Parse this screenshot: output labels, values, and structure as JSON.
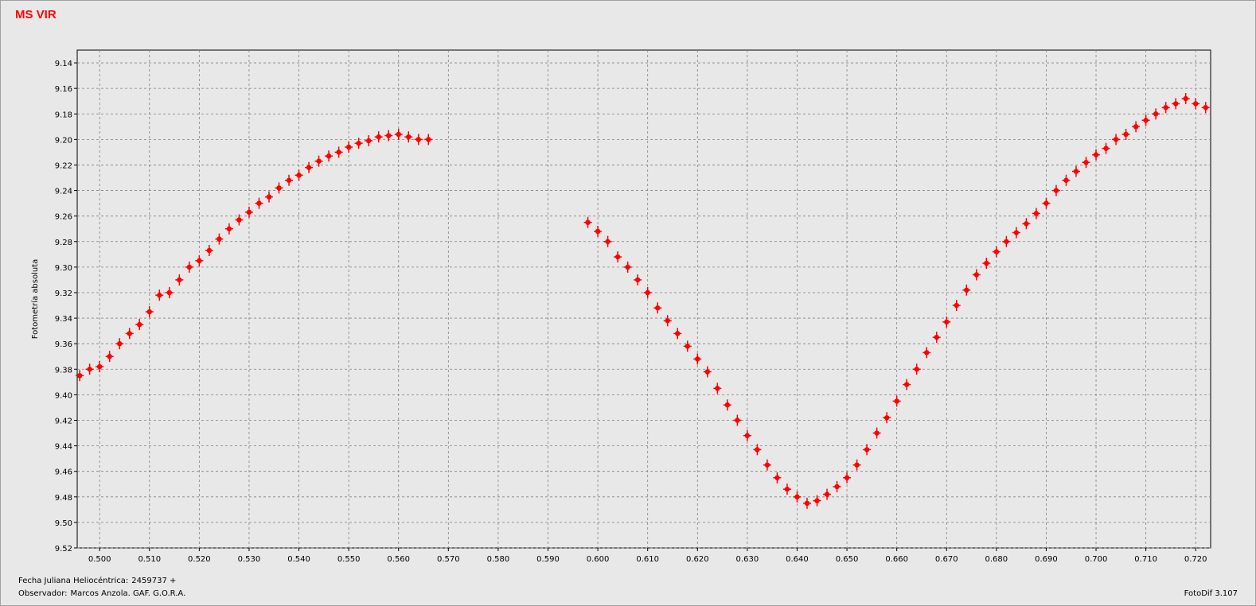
{
  "title": "MS VIR",
  "footer": {
    "hjd_label": "Fecha Juliana Heliocéntrica:",
    "hjd_value": "2459737 +",
    "observer_label": "Observador:",
    "observer_value": "Marcos Anzola. GAF. G.O.R.A.",
    "software": "FotoDif 3.107"
  },
  "colors": {
    "points": "#ff0000",
    "grid": "#808080",
    "background": "#e8e8e8"
  },
  "chart_data": {
    "type": "scatter",
    "title": "MS VIR",
    "xlabel": "Fecha Juliana Heliocéntrica: 2459737 +",
    "ylabel": "Fotometría absoluta",
    "xlim": [
      0.4955,
      0.723
    ],
    "ylim": [
      9.13,
      9.52
    ],
    "y_inverted": true,
    "grid": true,
    "legend": "none",
    "x_ticks": [
      "0.500",
      "0.510",
      "0.520",
      "0.530",
      "0.540",
      "0.550",
      "0.560",
      "0.570",
      "0.580",
      "0.590",
      "0.600",
      "0.610",
      "0.620",
      "0.630",
      "0.640",
      "0.650",
      "0.660",
      "0.670",
      "0.680",
      "0.690",
      "0.700",
      "0.710",
      "0.720"
    ],
    "y_ticks": [
      "9.14",
      "9.16",
      "9.18",
      "9.20",
      "9.22",
      "9.24",
      "9.26",
      "9.28",
      "9.30",
      "9.32",
      "9.34",
      "9.36",
      "9.38",
      "9.40",
      "9.42",
      "9.44",
      "9.46",
      "9.48",
      "9.50",
      "9.52"
    ],
    "series": [
      {
        "points": [
          [
            0.496,
            9.385
          ],
          [
            0.498,
            9.38
          ],
          [
            0.5,
            9.378
          ],
          [
            0.502,
            9.37
          ],
          [
            0.504,
            9.36
          ],
          [
            0.506,
            9.352
          ],
          [
            0.508,
            9.345
          ],
          [
            0.51,
            9.335
          ],
          [
            0.512,
            9.322
          ],
          [
            0.514,
            9.32
          ],
          [
            0.516,
            9.31
          ],
          [
            0.518,
            9.3
          ],
          [
            0.52,
            9.295
          ],
          [
            0.522,
            9.287
          ],
          [
            0.524,
            9.278
          ],
          [
            0.526,
            9.27
          ],
          [
            0.528,
            9.263
          ],
          [
            0.53,
            9.257
          ],
          [
            0.532,
            9.25
          ],
          [
            0.534,
            9.245
          ],
          [
            0.536,
            9.238
          ],
          [
            0.538,
            9.232
          ],
          [
            0.54,
            9.228
          ],
          [
            0.542,
            9.222
          ],
          [
            0.544,
            9.217
          ],
          [
            0.546,
            9.213
          ],
          [
            0.548,
            9.21
          ],
          [
            0.55,
            9.206
          ],
          [
            0.552,
            9.203
          ],
          [
            0.554,
            9.201
          ],
          [
            0.556,
            9.198
          ],
          [
            0.558,
            9.197
          ],
          [
            0.56,
            9.196
          ],
          [
            0.562,
            9.198
          ],
          [
            0.564,
            9.2
          ],
          [
            0.566,
            9.2
          ]
        ]
      },
      {
        "points": [
          [
            0.598,
            9.265
          ],
          [
            0.6,
            9.272
          ],
          [
            0.602,
            9.28
          ],
          [
            0.604,
            9.292
          ],
          [
            0.606,
            9.3
          ],
          [
            0.608,
            9.31
          ],
          [
            0.61,
            9.32
          ],
          [
            0.612,
            9.332
          ],
          [
            0.614,
            9.342
          ],
          [
            0.616,
            9.352
          ],
          [
            0.618,
            9.362
          ],
          [
            0.62,
            9.372
          ],
          [
            0.622,
            9.382
          ],
          [
            0.624,
            9.395
          ],
          [
            0.626,
            9.408
          ],
          [
            0.628,
            9.42
          ],
          [
            0.63,
            9.432
          ],
          [
            0.632,
            9.443
          ],
          [
            0.634,
            9.455
          ],
          [
            0.636,
            9.465
          ],
          [
            0.638,
            9.474
          ],
          [
            0.64,
            9.48
          ],
          [
            0.642,
            9.485
          ],
          [
            0.644,
            9.483
          ],
          [
            0.646,
            9.478
          ],
          [
            0.648,
            9.472
          ],
          [
            0.65,
            9.465
          ],
          [
            0.652,
            9.455
          ],
          [
            0.654,
            9.443
          ],
          [
            0.656,
            9.43
          ],
          [
            0.658,
            9.418
          ],
          [
            0.66,
            9.405
          ],
          [
            0.662,
            9.392
          ],
          [
            0.664,
            9.38
          ],
          [
            0.666,
            9.367
          ],
          [
            0.668,
            9.355
          ],
          [
            0.67,
            9.343
          ],
          [
            0.672,
            9.33
          ],
          [
            0.674,
            9.318
          ],
          [
            0.676,
            9.306
          ],
          [
            0.678,
            9.297
          ],
          [
            0.68,
            9.288
          ],
          [
            0.682,
            9.28
          ],
          [
            0.684,
            9.273
          ],
          [
            0.686,
            9.266
          ],
          [
            0.688,
            9.258
          ],
          [
            0.69,
            9.25
          ],
          [
            0.692,
            9.24
          ],
          [
            0.694,
            9.232
          ],
          [
            0.696,
            9.225
          ],
          [
            0.698,
            9.218
          ],
          [
            0.7,
            9.212
          ],
          [
            0.702,
            9.207
          ],
          [
            0.704,
            9.2
          ],
          [
            0.706,
            9.196
          ],
          [
            0.708,
            9.19
          ],
          [
            0.71,
            9.185
          ],
          [
            0.712,
            9.18
          ],
          [
            0.714,
            9.175
          ],
          [
            0.716,
            9.172
          ],
          [
            0.718,
            9.168
          ],
          [
            0.72,
            9.172
          ],
          [
            0.722,
            9.175
          ]
        ]
      }
    ]
  }
}
